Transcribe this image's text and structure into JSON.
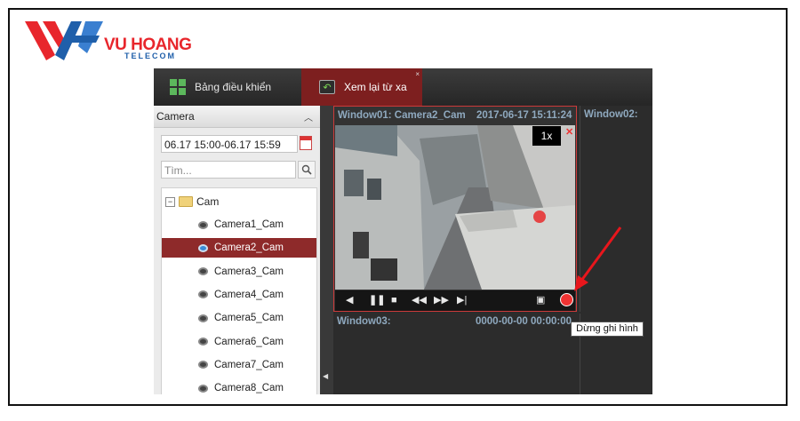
{
  "logo": {
    "name": "VU HOANG",
    "sub": "TELECOM",
    "colors": {
      "red": "#e8262c",
      "blue": "#1f5faa"
    }
  },
  "topbar": {
    "tab_dashboard": "Bảng điều khiển",
    "tab_playback": "Xem lại từ xa"
  },
  "sidebar": {
    "title": "Camera",
    "date_range": "06.17 15:00-06.17 15:59",
    "search_placeholder": "Tìm...",
    "root": "Cam",
    "cameras": [
      "Camera1_Cam",
      "Camera2_Cam",
      "Camera3_Cam",
      "Camera4_Cam",
      "Camera5_Cam",
      "Camera6_Cam",
      "Camera7_Cam",
      "Camera8_Cam"
    ],
    "selected_index": 1
  },
  "windows": {
    "w1_title": "Window01:  Camera2_Cam",
    "w1_time": "2017-06-17 15:11:24",
    "w1_speed": "1x",
    "w2_title": "Window02:",
    "w3_title": "Window03:",
    "w3_time": "0000-00-00 00:00:00"
  },
  "tooltip": "Dừng ghi hình",
  "colors": {
    "accent": "#7d1f1f",
    "selected_row": "#8e2a2a",
    "title_text": "#8fa9bf"
  }
}
